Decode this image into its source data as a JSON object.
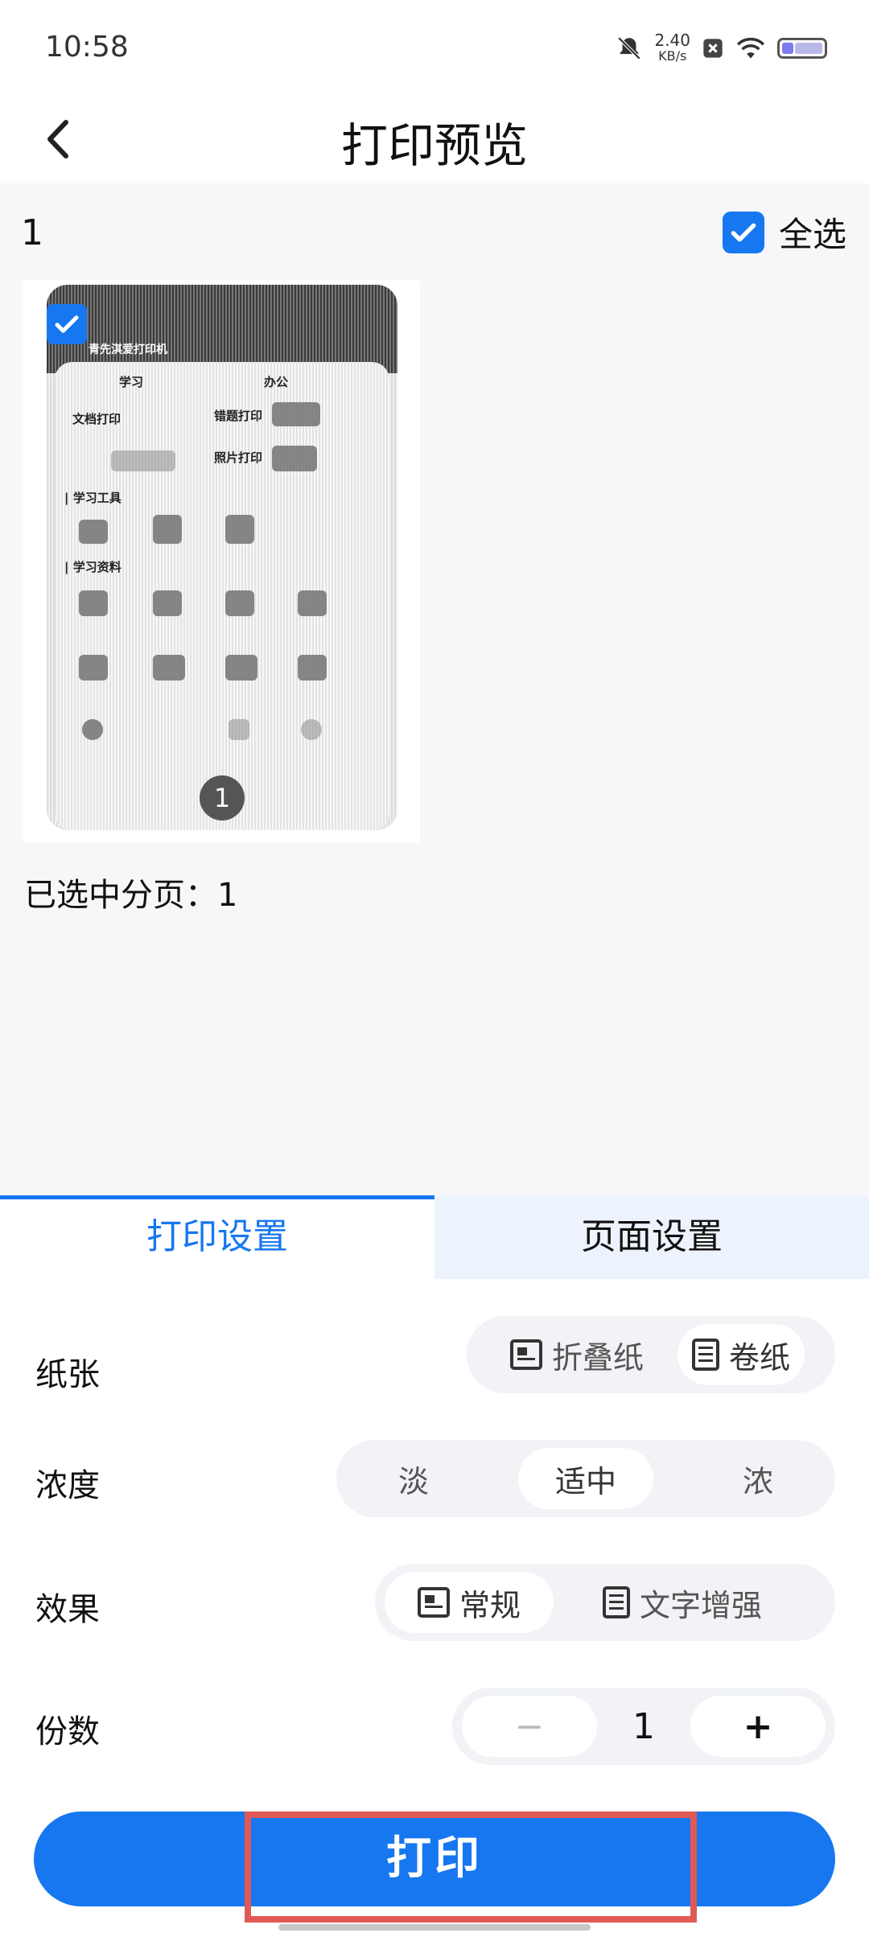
{
  "status_bar": {
    "time": "10:58",
    "speed_value": "2.40",
    "speed_unit": "KB/s",
    "icons": [
      "mute-icon",
      "network-speed",
      "close-box-icon",
      "wifi-icon",
      "battery-icon"
    ]
  },
  "header": {
    "title": "打印预览",
    "back_icon": "chevron-left-icon"
  },
  "preview": {
    "page_count": "1",
    "select_all_label": "全选",
    "select_all_checked": true,
    "pages": [
      {
        "badge": "1",
        "checked": true
      }
    ],
    "thumb_texts": {
      "app_name": "青先淇爱打印机",
      "tab_study": "学习",
      "tab_office": "办公",
      "doc_print": "文档打印",
      "error_print": "错题打印",
      "photo_print": "照片打印",
      "study_tools": "| 学习工具",
      "study_materials": "| 学习资料"
    },
    "selected_info": "已选中分页：1"
  },
  "tabs": [
    {
      "label": "打印设置",
      "active": true
    },
    {
      "label": "页面设置",
      "active": false
    }
  ],
  "settings": {
    "paper": {
      "label": "纸张",
      "options": [
        "折叠纸",
        "卷纸"
      ],
      "selected": "卷纸"
    },
    "density": {
      "label": "浓度",
      "options": [
        "淡",
        "适中",
        "浓"
      ],
      "selected": "适中"
    },
    "effect": {
      "label": "效果",
      "options": [
        "常规",
        "文字增强"
      ],
      "selected": "常规"
    },
    "copies": {
      "label": "份数",
      "minus": "−",
      "value": "1",
      "plus": "+"
    }
  },
  "print_button": "打印",
  "colors": {
    "accent": "#1677f0",
    "highlight": "#e05a55",
    "background": "#f7f7f9"
  }
}
